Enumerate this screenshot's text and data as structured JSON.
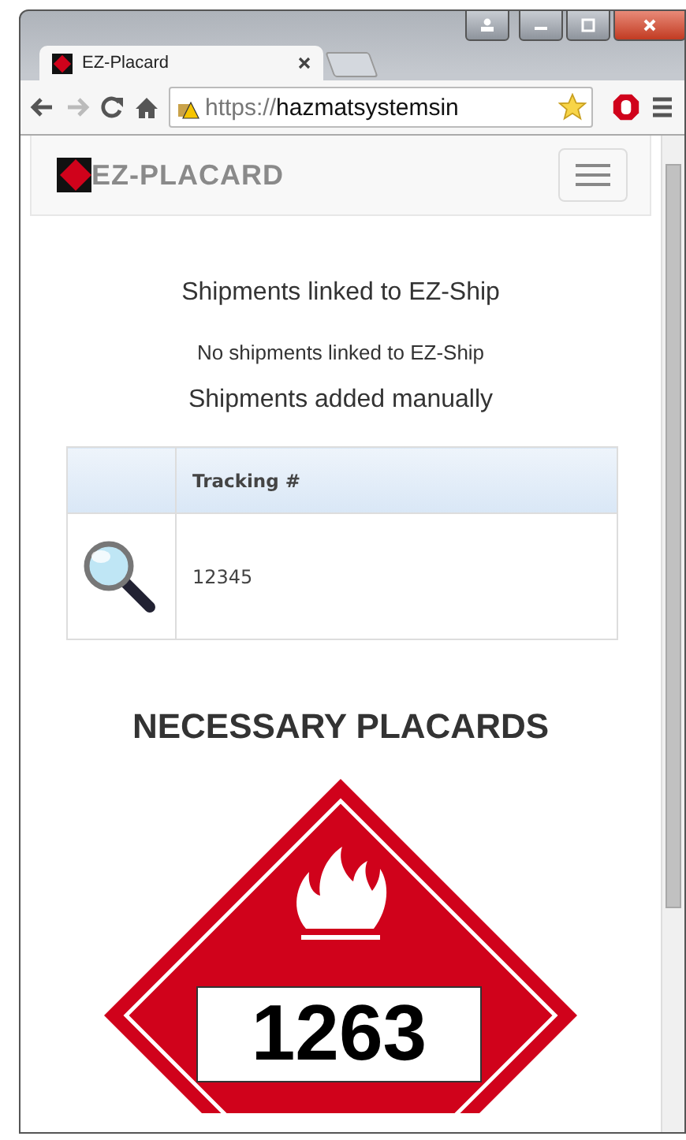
{
  "browser": {
    "tab_title": "EZ-Placard",
    "url": "https://hazmatsystemsin"
  },
  "navbar": {
    "brand": "EZ-PLACARD"
  },
  "linked": {
    "heading": "Shipments linked to EZ-Ship",
    "message": "No shipments linked to EZ-Ship"
  },
  "manual": {
    "heading": "Shipments added manually",
    "header": "Tracking #",
    "rows": [
      {
        "tracking": "12345"
      }
    ]
  },
  "placards": {
    "heading": "NECESSARY PLACARDS",
    "items": [
      {
        "number": "1263"
      }
    ]
  }
}
